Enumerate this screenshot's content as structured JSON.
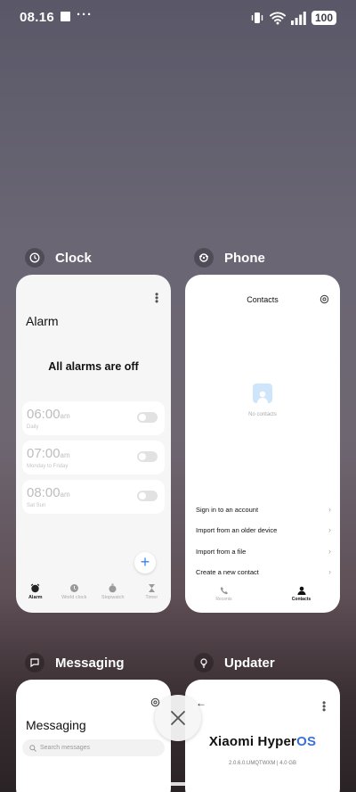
{
  "status_bar": {
    "time": "08.16",
    "more": "···",
    "battery": "100"
  },
  "cards": {
    "clock": {
      "app_name": "Clock",
      "screen_title": "Alarm",
      "empty_message": "All alarms are off",
      "alarms": [
        {
          "hour": "06:00",
          "ampm": "am",
          "repeat": "Daily"
        },
        {
          "hour": "07:00",
          "ampm": "am",
          "repeat": "Monday to Friday"
        },
        {
          "hour": "08:00",
          "ampm": "am",
          "repeat": "Sat Sun"
        }
      ],
      "add_label": "+",
      "tabs": [
        "Alarm",
        "World clock",
        "Stopwatch",
        "Timer"
      ]
    },
    "phone": {
      "app_name": "Phone",
      "screen_title": "Contacts",
      "empty_text": "No contacts",
      "options": [
        "Sign in to an account",
        "Import from an older device",
        "Import from a file",
        "Create a new contact"
      ],
      "tabs": [
        "Recents",
        "Contacts"
      ]
    },
    "messaging": {
      "app_name": "Messaging",
      "screen_title": "Messaging",
      "search_placeholder": "Search messages"
    },
    "updater": {
      "app_name": "Updater",
      "brand_prefix": "Xiaomi Hyper",
      "brand_suffix": "OS",
      "version": "2.0.6.0.UMQTWXM | 4.0 GB"
    }
  },
  "colors": {
    "accent": "#3b82f6",
    "brand_os": "#3b6fd6"
  }
}
